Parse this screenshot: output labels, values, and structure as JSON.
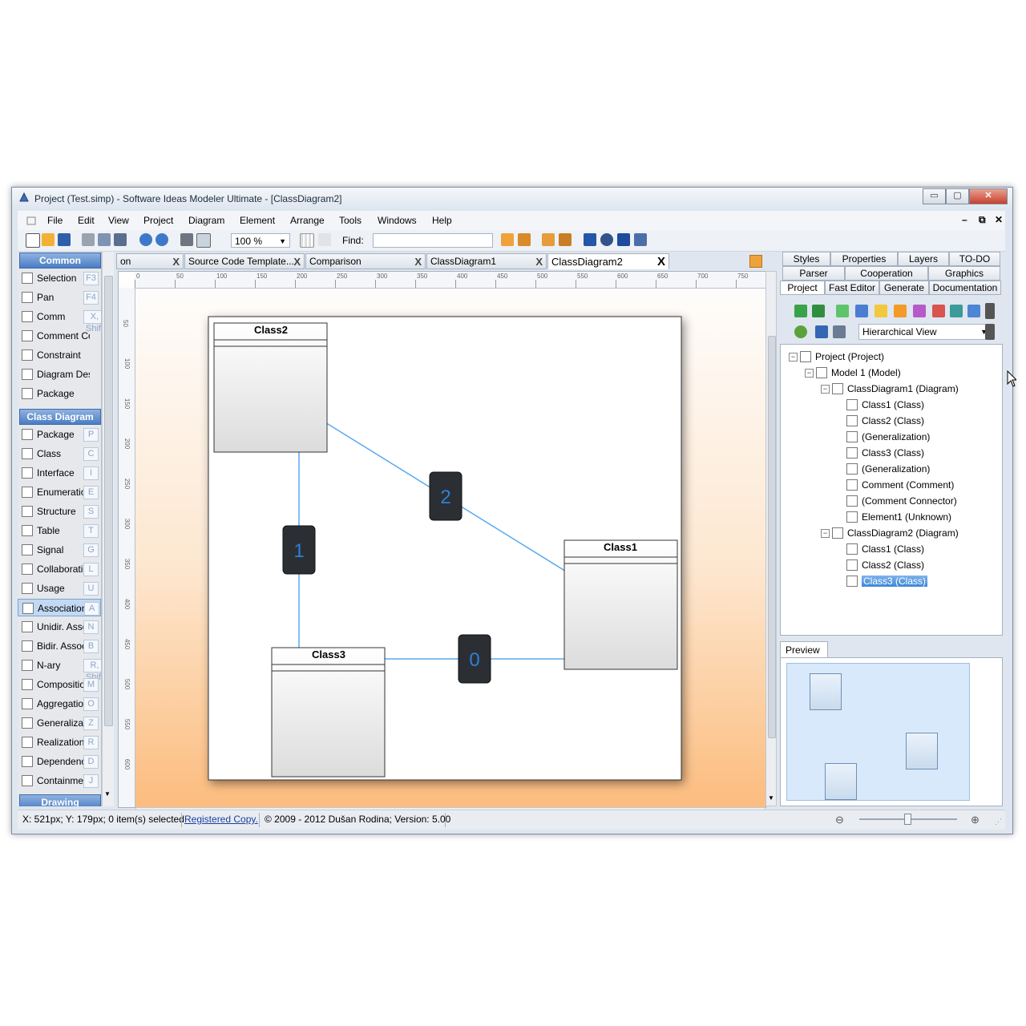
{
  "window": {
    "title": "Project (Test.simp)  - Software Ideas Modeler Ultimate - [ClassDiagram2]",
    "minimize": "▭",
    "maximize": "▢",
    "close": "✕"
  },
  "menu": {
    "items": [
      "File",
      "Edit",
      "View",
      "Project",
      "Diagram",
      "Element",
      "Arrange",
      "Tools",
      "Windows",
      "Help"
    ],
    "mdi_min": "–",
    "mdi_restore": "⧉",
    "mdi_close": "✕"
  },
  "toolbar": {
    "zoom": "100 %",
    "find_label": "Find:",
    "find_value": ""
  },
  "toolbox": {
    "common_header": "Common",
    "common_items": [
      {
        "label": "Selection",
        "key": "F3"
      },
      {
        "label": "Pan",
        "key": "F4"
      },
      {
        "label": "Comm",
        "key": "X, Shift"
      },
      {
        "label": "Comment Co...",
        "key": ""
      },
      {
        "label": "Constraint",
        "key": ""
      },
      {
        "label": "Diagram Des...",
        "key": ""
      },
      {
        "label": "Package",
        "key": ""
      }
    ],
    "class_header": "Class Diagram",
    "class_items": [
      {
        "label": "Package",
        "key": "P"
      },
      {
        "label": "Class",
        "key": "C"
      },
      {
        "label": "Interface",
        "key": "I"
      },
      {
        "label": "Enumeration",
        "key": "E"
      },
      {
        "label": "Structure",
        "key": "S"
      },
      {
        "label": "Table",
        "key": "T"
      },
      {
        "label": "Signal",
        "key": "G"
      },
      {
        "label": "Collaboration",
        "key": "L"
      },
      {
        "label": "Usage",
        "key": "U"
      },
      {
        "label": "Association",
        "key": "A"
      },
      {
        "label": "Unidir. Asso...",
        "key": "N"
      },
      {
        "label": "Bidir. Assoc...",
        "key": "B"
      },
      {
        "label": "N-ary",
        "key": "R, Shift"
      },
      {
        "label": "Composition",
        "key": "M"
      },
      {
        "label": "Aggregation",
        "key": "O"
      },
      {
        "label": "Generalization",
        "key": "Z"
      },
      {
        "label": "Realization",
        "key": "R"
      },
      {
        "label": "Dependency",
        "key": "D"
      },
      {
        "label": "Containment",
        "key": "J"
      }
    ],
    "drawing_header": "Drawing"
  },
  "tabs": [
    {
      "label": "on",
      "close": "X"
    },
    {
      "label": "Source Code Template...",
      "close": "X"
    },
    {
      "label": "Comparison",
      "close": "X"
    },
    {
      "label": "ClassDiagram1",
      "close": "X"
    },
    {
      "label": "ClassDiagram2",
      "close": "X"
    }
  ],
  "diagram": {
    "classes": [
      {
        "name": "Class2"
      },
      {
        "name": "Class1"
      },
      {
        "name": "Class3"
      }
    ],
    "badges": [
      "1",
      "2",
      "0"
    ],
    "line_color": "#5aa8f0"
  },
  "ruler": {
    "h_labels": [
      "0",
      "50",
      "100",
      "150",
      "200",
      "250",
      "300",
      "350",
      "400",
      "450",
      "500",
      "550",
      "600",
      "650",
      "700",
      "750"
    ],
    "v_labels": [
      "50",
      "100",
      "150",
      "200",
      "250",
      "300",
      "350",
      "400",
      "450",
      "500",
      "550",
      "600"
    ]
  },
  "right_panel": {
    "tabs_row1": [
      "Styles",
      "Properties",
      "Layers",
      "TO-DO"
    ],
    "tabs_row2": [
      "Parser",
      "Cooperation",
      "Graphics"
    ],
    "tabs_row3": [
      "Project",
      "Fast Editor",
      "Generate",
      "Documentation"
    ],
    "view_mode": "Hierarchical View",
    "tree": [
      {
        "label": "Project (Project)",
        "level": 0,
        "exp": "−"
      },
      {
        "label": "Model 1 (Model)",
        "level": 1,
        "exp": "−"
      },
      {
        "label": "ClassDiagram1 (Diagram)",
        "level": 2,
        "exp": "−"
      },
      {
        "label": "Class1 (Class)",
        "level": 3,
        "exp": ""
      },
      {
        "label": "Class2 (Class)",
        "level": 3,
        "exp": ""
      },
      {
        "label": "(Generalization)",
        "level": 3,
        "exp": ""
      },
      {
        "label": "Class3 (Class)",
        "level": 3,
        "exp": ""
      },
      {
        "label": "(Generalization)",
        "level": 3,
        "exp": ""
      },
      {
        "label": "Comment (Comment)",
        "level": 3,
        "exp": ""
      },
      {
        "label": "(Comment Connector)",
        "level": 3,
        "exp": ""
      },
      {
        "label": "Element1 (Unknown)",
        "level": 3,
        "exp": ""
      },
      {
        "label": "ClassDiagram2 (Diagram)",
        "level": 2,
        "exp": "−"
      },
      {
        "label": "Class1 (Class)",
        "level": 3,
        "exp": ""
      },
      {
        "label": "Class2 (Class)",
        "level": 3,
        "exp": ""
      },
      {
        "label": "Class3 (Class)",
        "level": 3,
        "exp": "",
        "selected": true
      }
    ],
    "preview_tab": "Preview"
  },
  "status": {
    "coords": "X: 521px; Y: 179px; 0 item(s) selected",
    "registered": "Registered Copy.",
    "copyright": "© 2009 - 2012 Dušan Rodina; Version: 5.00"
  }
}
